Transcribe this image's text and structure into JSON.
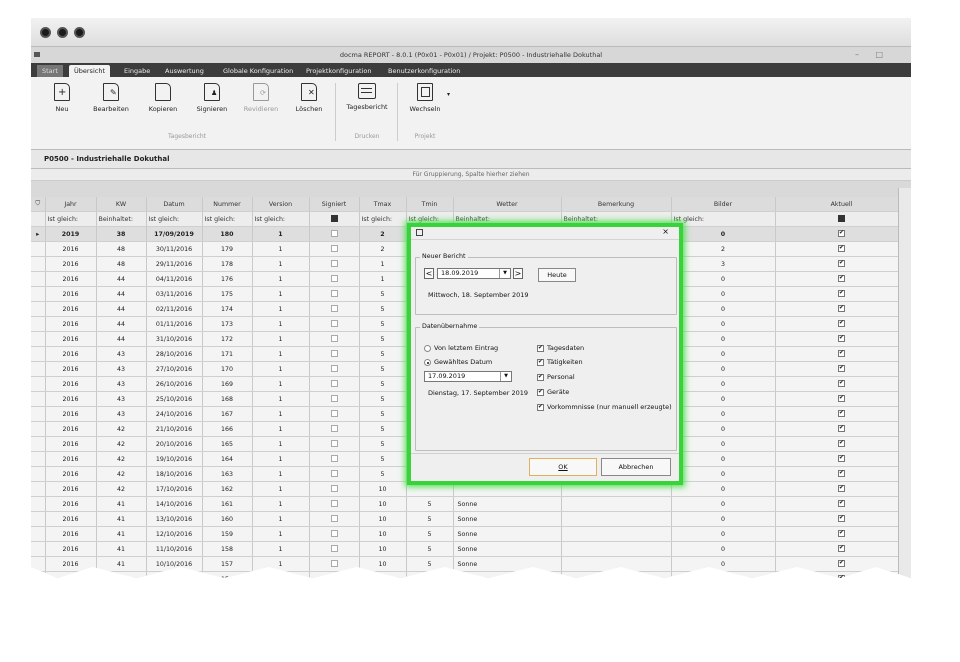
{
  "window": {
    "title": "docma REPORT - 8.0.1 (P0x01 - P0x01) / Projekt: P0500 - Industriehalle Dokuthal",
    "minimize_glyph": "–",
    "maximize_glyph": "□"
  },
  "ribbon_tabs": [
    "Start",
    "Übersicht",
    "Eingabe",
    "Auswertung",
    "Globale Konfiguration",
    "Projektkonfiguration",
    "Benutzerkonfiguration"
  ],
  "ribbon": {
    "buttons": {
      "neu": "Neu",
      "bearbeiten": "Bearbeiten",
      "kopieren": "Kopieren",
      "signieren": "Signieren",
      "revidieren": "Revidieren",
      "loeschen": "Löschen",
      "tagesbericht": "Tagesbericht",
      "wechseln": "Wechseln"
    },
    "groups": {
      "tagesbericht": "Tagesbericht",
      "drucken": "Drucken",
      "projekt": "Projekt"
    }
  },
  "project_title": "P0500 - Industriehalle Dokuthal",
  "group_hint": "Für Gruppierung, Spalte hierher ziehen",
  "grid": {
    "columns": [
      "Jahr",
      "KW",
      "Datum",
      "Nummer",
      "Version",
      "Signiert",
      "Tmax",
      "Tmin",
      "Wetter",
      "Bemerkung",
      "Bilder",
      "Aktuell"
    ],
    "filters": [
      "Ist gleich:",
      "Beinhaltet:",
      "Ist gleich:",
      "Ist gleich:",
      "Ist gleich:",
      "",
      "Ist gleich:",
      "Ist gleich:",
      "Beinhaltet:",
      "Beinhaltet:",
      "Ist gleich:",
      ""
    ],
    "rows": [
      [
        "2019",
        "38",
        "17/09/2019",
        "180",
        "1",
        "2",
        "",
        "",
        "",
        "0"
      ],
      [
        "2016",
        "48",
        "30/11/2016",
        "179",
        "1",
        "2",
        "",
        "",
        "",
        "2"
      ],
      [
        "2016",
        "48",
        "29/11/2016",
        "178",
        "1",
        "1",
        "",
        "",
        "",
        "3"
      ],
      [
        "2016",
        "44",
        "04/11/2016",
        "176",
        "1",
        "1",
        "",
        "",
        "",
        "0"
      ],
      [
        "2016",
        "44",
        "03/11/2016",
        "175",
        "1",
        "5",
        "",
        "",
        "",
        "0"
      ],
      [
        "2016",
        "44",
        "02/11/2016",
        "174",
        "1",
        "5",
        "",
        "",
        "",
        "0"
      ],
      [
        "2016",
        "44",
        "01/11/2016",
        "173",
        "1",
        "5",
        "",
        "",
        "",
        "0"
      ],
      [
        "2016",
        "44",
        "31/10/2016",
        "172",
        "1",
        "5",
        "",
        "",
        "",
        "0"
      ],
      [
        "2016",
        "43",
        "28/10/2016",
        "171",
        "1",
        "5",
        "",
        "",
        "",
        "0"
      ],
      [
        "2016",
        "43",
        "27/10/2016",
        "170",
        "1",
        "5",
        "",
        "",
        "",
        "0"
      ],
      [
        "2016",
        "43",
        "26/10/2016",
        "169",
        "1",
        "5",
        "",
        "",
        "",
        "0"
      ],
      [
        "2016",
        "43",
        "25/10/2016",
        "168",
        "1",
        "5",
        "",
        "",
        "",
        "0"
      ],
      [
        "2016",
        "43",
        "24/10/2016",
        "167",
        "1",
        "5",
        "",
        "",
        "",
        "0"
      ],
      [
        "2016",
        "42",
        "21/10/2016",
        "166",
        "1",
        "5",
        "",
        "",
        "",
        "0"
      ],
      [
        "2016",
        "42",
        "20/10/2016",
        "165",
        "1",
        "5",
        "",
        "",
        "",
        "0"
      ],
      [
        "2016",
        "42",
        "19/10/2016",
        "164",
        "1",
        "5",
        "",
        "",
        "",
        "0"
      ],
      [
        "2016",
        "42",
        "18/10/2016",
        "163",
        "1",
        "5",
        "",
        "",
        "",
        "0"
      ],
      [
        "2016",
        "42",
        "17/10/2016",
        "162",
        "1",
        "10",
        "",
        "",
        "",
        "0"
      ],
      [
        "2016",
        "41",
        "14/10/2016",
        "161",
        "1",
        "10",
        "5",
        "Sonne",
        "",
        "0"
      ],
      [
        "2016",
        "41",
        "13/10/2016",
        "160",
        "1",
        "10",
        "5",
        "Sonne",
        "",
        "0"
      ],
      [
        "2016",
        "41",
        "12/10/2016",
        "159",
        "1",
        "10",
        "5",
        "Sonne",
        "",
        "0"
      ],
      [
        "2016",
        "41",
        "11/10/2016",
        "158",
        "1",
        "10",
        "5",
        "Sonne",
        "",
        "0"
      ],
      [
        "2016",
        "41",
        "10/10/2016",
        "157",
        "1",
        "10",
        "5",
        "Sonne",
        "",
        "0"
      ],
      [
        "2016",
        "40",
        "07/10/2016",
        "156",
        "1",
        "10",
        "5",
        "Sonne",
        "",
        "0"
      ]
    ]
  },
  "dialog": {
    "close_glyph": "×",
    "new_report": {
      "legend": "Neuer Bericht",
      "date": "18.09.2019",
      "date_long": "Mittwoch, 18. September 2019",
      "today_button": "Heute",
      "prev_glyph": "<",
      "next_glyph": ">"
    },
    "data_import": {
      "legend": "Datenübernahme",
      "radio_last": "Von letztem Eintrag",
      "radio_selected": "Gewähltes Datum",
      "selected_date": "17.09.2019",
      "selected_date_long": "Dienstag, 17. September 2019",
      "checkboxes": [
        "Tagesdaten",
        "Tätigkeiten",
        "Personal",
        "Geräte",
        "Vorkommnisse (nur manuell erzeugte)"
      ]
    },
    "ok_button": "OK",
    "cancel_button": "Abbrechen"
  },
  "colors": {
    "highlight_glow": "#38d23a",
    "ribbon_tabs_bg": "#3c3c3c"
  }
}
